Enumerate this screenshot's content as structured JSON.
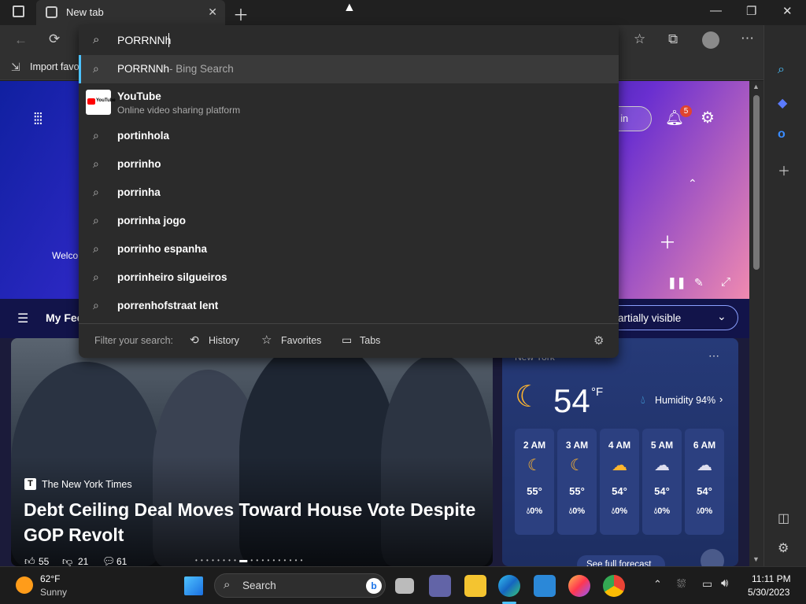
{
  "browser": {
    "tab_title": "New tab",
    "favbar_text": "Import favo",
    "address_value": "PORRNNh"
  },
  "suggestions": {
    "bing_query": "PORRNNh",
    "bing_suffix": "- Bing Search",
    "site_title": "YouTube",
    "site_desc": "Online video sharing platform",
    "site_logo_text": "YouTube",
    "items": [
      "portinhola",
      "porrinho",
      "porrinha",
      "porrinha jogo",
      "porrinho espanha",
      "porrinheiro silgueiros",
      "porrenhofstraat lent"
    ]
  },
  "filter": {
    "label": "Filter your search:",
    "history": "History",
    "favorites": "Favorites",
    "tabs": "Tabs"
  },
  "newtab": {
    "signin": "gn in",
    "notif_count": "5",
    "welcome": "Welco",
    "feed_label": "My Fee",
    "visibility": "artially visible"
  },
  "news": {
    "source": "The New York Times",
    "headline": "Debt Ceiling Deal Moves Toward House Vote Despite GOP Revolt",
    "likes": "55",
    "dislikes": "21",
    "comments": "61"
  },
  "weather": {
    "location": "New York",
    "temp": "54",
    "unit": "°F",
    "humidity": "Humidity 94%",
    "hours": [
      {
        "time": "2 AM",
        "temp": "55°",
        "rain": "0%"
      },
      {
        "time": "3 AM",
        "temp": "55°",
        "rain": "0%"
      },
      {
        "time": "4 AM",
        "temp": "54°",
        "rain": "0%"
      },
      {
        "time": "5 AM",
        "temp": "54°",
        "rain": "0%"
      },
      {
        "time": "6 AM",
        "temp": "54°",
        "rain": "0%"
      }
    ],
    "forecast_button": "See full forecast"
  },
  "taskbar": {
    "weather_temp": "62°F",
    "weather_cond": "Sunny",
    "search": "Search",
    "time": "11:11 PM",
    "date": "5/30/2023"
  },
  "colors": {
    "accent": "#4cc2ff",
    "notif_badge": "#e0442e",
    "bing_blue": "#1a73e8"
  }
}
